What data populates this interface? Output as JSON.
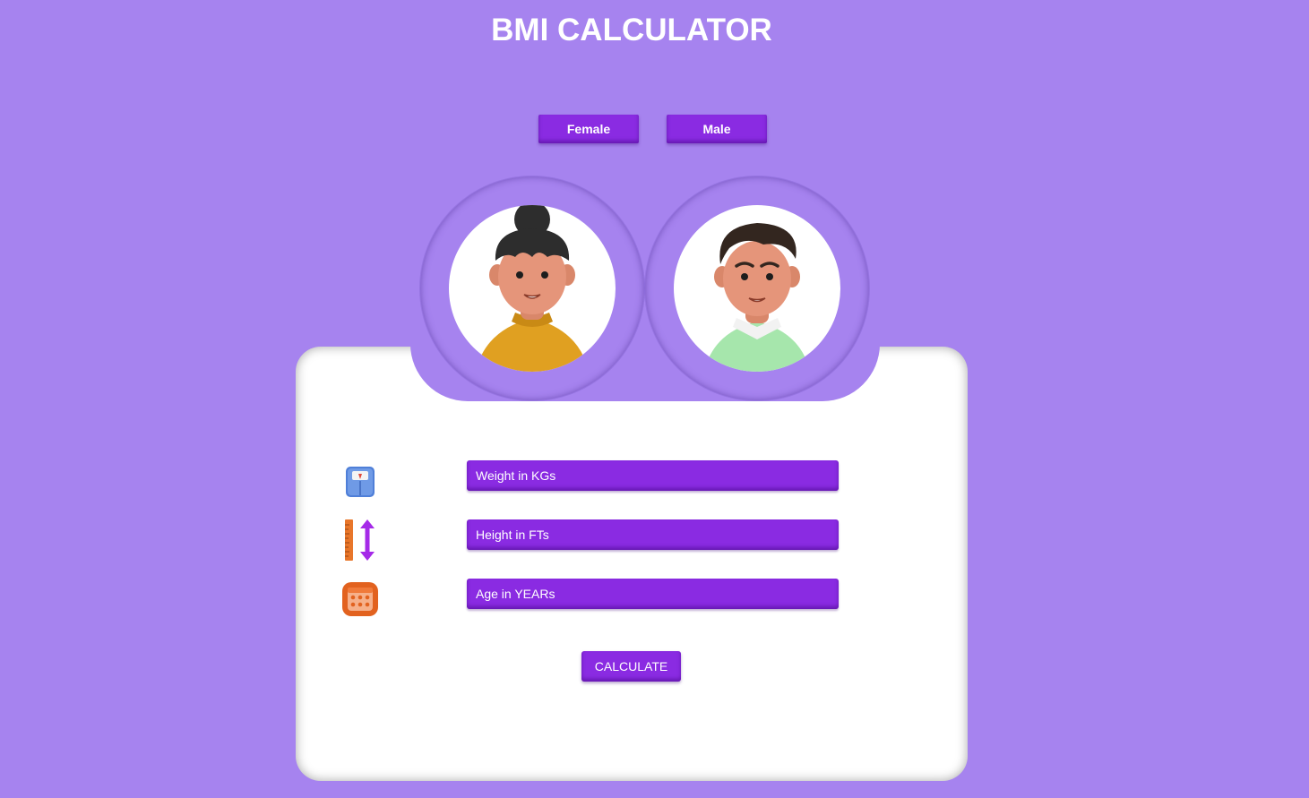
{
  "header": {
    "title": "BMI CALCULATOR"
  },
  "gender": {
    "female_label": "Female",
    "male_label": "Male"
  },
  "form": {
    "weight": {
      "placeholder": "Weight in KGs",
      "value": ""
    },
    "height": {
      "placeholder": "Height in FTs",
      "value": ""
    },
    "age": {
      "placeholder": "Age in YEARs",
      "value": ""
    },
    "calculate_label": "CALCULATE"
  },
  "icons": {
    "weight": "weighing-scale-icon",
    "height": "ruler-height-icon",
    "age": "calendar-icon",
    "female_avatar": "female-avatar",
    "male_avatar": "male-avatar"
  },
  "colors": {
    "background": "#a683ef",
    "accent": "#8a2be2",
    "card": "#ffffff",
    "text_light": "#ffffff"
  }
}
